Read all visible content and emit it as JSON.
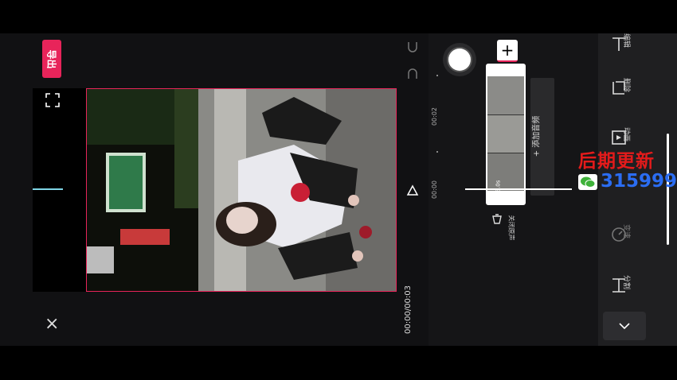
{
  "app": {
    "export_label": "导出",
    "time_readout": "00:00/00:03",
    "close_label": "×"
  },
  "timeline": {
    "marks": [
      "00:00",
      "00:02"
    ],
    "clip_duration": "3.0s",
    "add_audio": "+ 添加音频",
    "mute_label": "关闭原声",
    "add_clip": "+"
  },
  "toolbar": {
    "items": [
      {
        "label": "编辑",
        "icon": "edit-icon"
      },
      {
        "label": "删除",
        "icon": "delete-icon"
      },
      {
        "label": "动画",
        "icon": "animation-icon"
      },
      {
        "label": "变速",
        "icon": "speed-icon"
      },
      {
        "label": "分割",
        "icon": "split-icon"
      }
    ],
    "collapse_icon": "chevron-down-icon"
  },
  "overlay": {
    "promo_text": "后期更新",
    "promo_number": "315999"
  },
  "colors": {
    "accent": "#e8245a",
    "panel": "#1b1b1d",
    "playhead": "#ffffff",
    "watermark_red": "#e31b1b",
    "watermark_blue": "#2b6df2"
  }
}
